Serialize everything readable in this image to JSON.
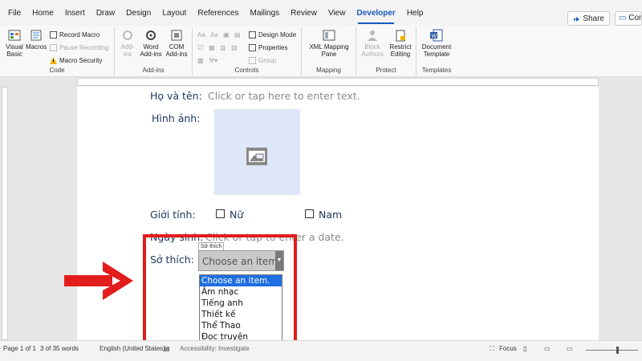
{
  "menu": {
    "tabs": [
      "File",
      "Home",
      "Insert",
      "Draw",
      "Design",
      "Layout",
      "References",
      "Mailings",
      "Review",
      "View",
      "Developer",
      "Help"
    ],
    "active": "Developer",
    "share": "Share",
    "comments": "Comments"
  },
  "ribbon": {
    "code": {
      "label": "Code",
      "visual_basic": "Visual Basic",
      "macros": "Macros",
      "record_macro": "Record Macro",
      "pause_recording": "Pause Recording",
      "macro_security": "Macro Security"
    },
    "addins": {
      "label": "Add-ins",
      "addins": "Add-ins",
      "word_addins": "Word Add-ins",
      "com_addins": "COM Add-ins"
    },
    "controls": {
      "label": "Controls",
      "design_mode": "Design Mode",
      "properties": "Properties",
      "group": "Group"
    },
    "mapping": {
      "label": "Mapping",
      "xml_pane": "XML Mapping Pane"
    },
    "protect": {
      "label": "Protect",
      "block_authors": "Block Authors",
      "restrict_editing": "Restrict Editing"
    },
    "templates": {
      "label": "Templates",
      "document_template": "Document Template"
    }
  },
  "document": {
    "name_label": "Họ và tên:",
    "name_placeholder": "Click or tap here to enter text.",
    "image_label": "Hình ảnh:",
    "gender_label": "Giới tính:",
    "gender_male": "Nữ",
    "gender_female": "Nam",
    "dob_label": "Ngày sinh:",
    "dob_placeholder": "Click or tap to enter a date.",
    "hobby_label": "Sở thích:",
    "hobby_tag": "Sở thích",
    "combo_value": "Choose an item.",
    "dropdown_options": [
      "Choose an item.",
      "Âm nhạc",
      "Tiếng anh",
      "Thiết kế",
      "Thể Thao",
      "Đọc truyện"
    ],
    "selected_index": 0
  },
  "status": {
    "page": "Page 1 of 1",
    "words": "3 of 35 words",
    "language": "English (United States)",
    "accessibility": "Accessibility: Investigate",
    "focus": "Focus"
  },
  "colors": {
    "accent": "#185abd",
    "highlight_frame": "#e31c1c",
    "selection": "#1e6fe0"
  }
}
